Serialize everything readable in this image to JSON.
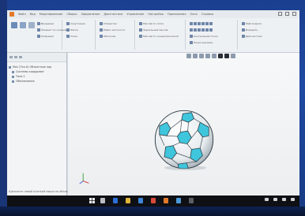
{
  "menu": {
    "items": [
      "Файл",
      "Вид",
      "Моделирование",
      "Сборка",
      "Оформление",
      "Диагностика",
      "Управление",
      "Настройка",
      "Приложения",
      "Окно",
      "Справка"
    ]
  },
  "ribbon": {
    "groups": [
      {
        "items": [
          "Вращение",
          "Элемент по сечениям",
          "Операция"
        ]
      },
      {
        "items": [
          "Скругление",
          "Фаска",
          "Уклон"
        ]
      },
      {
        "items": [
          "Отверстие",
          "Ребро жесткости",
          "Оболочка"
        ]
      },
      {
        "items": [
          "Массив по сетке",
          "Зеркальный массив",
          "Массив по концентрической"
        ]
      },
      {
        "items": [
          "Контрольная точка",
          "Линия разъема"
        ]
      },
      {
        "items": [
          "МЦХ модели",
          "Измерить",
          "Диагностика"
        ]
      }
    ]
  },
  "tree": {
    "root": "Мяч (Тел-0) Объектные пар",
    "items": [
      "Системы координат",
      "Тела 1",
      "Обозначения"
    ]
  },
  "status": {
    "hint": "Щелкните левой кнопкой мыши на объекте для его выделения"
  },
  "scene": {
    "ball_white": "#f4f6f7",
    "ball_cyan": "#3fc6dd",
    "seam": "#2f3b44"
  }
}
